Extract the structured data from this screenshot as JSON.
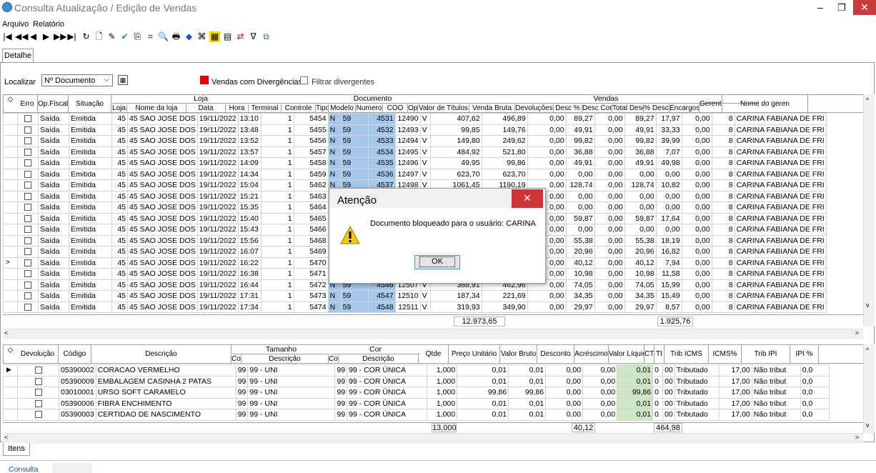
{
  "window": {
    "title": "Consulta Atualização / Edição de Vendas",
    "min": "–",
    "max": "❐",
    "close": "✕"
  },
  "menu": [
    "Arquivo",
    "Relatório"
  ],
  "toolbar": [
    "|◀",
    "◀◀",
    "◀",
    "▶",
    "▶▶",
    "▶|",
    "↻",
    "🗋",
    "✎",
    "✔",
    "⎘",
    "⌗",
    "🔍",
    "🖶",
    "◆",
    "⌘",
    "▦",
    "▤",
    "⇄",
    "∇",
    "⧉"
  ],
  "tabs": {
    "detalhe": "Detalhe",
    "itens": "Itens"
  },
  "filter": {
    "localizar": "Localizar",
    "select": "Nº Documento",
    "legend": "Vendas com Divergências",
    "filtrar": "Filtrar divergentes"
  },
  "colors": {
    "accent": "#a6c8ec",
    "liquido": "#cde6c5",
    "divergencia": "#e60000"
  },
  "sales": {
    "groups": {
      "loja": "Loja",
      "documento": "Documento",
      "vendas": "Vendas"
    },
    "columns": [
      "Erro",
      "Op.Fiscal",
      "Situação",
      "Loja",
      "Nome da loja",
      "Data",
      "Hora",
      "Terminal",
      "Controle",
      "Tipo",
      "Modelo",
      "Numero",
      "COO",
      "Op",
      "Valor de Títulos",
      "Venda Bruta",
      "Devoluções",
      "Desc %",
      "Desc Cort",
      "Total Desc",
      "% Desc",
      "Encargos",
      "Gerente",
      "Nome do geren"
    ],
    "rows": [
      [
        "Saída",
        "Emitida",
        "45",
        "45 SAO JOSE DOS",
        "19/11/2022",
        "13:10",
        "1",
        "5454",
        "N",
        "59",
        "4531",
        "12490",
        "V",
        "407,62",
        "496,89",
        "0,00",
        "89,27",
        "0,00",
        "89,27",
        "17,97",
        "0,00",
        "8",
        "CARINA FABIANA DE FRI"
      ],
      [
        "Saída",
        "Emitida",
        "45",
        "45 SAO JOSE DOS",
        "19/11/2022",
        "13:48",
        "1",
        "5455",
        "N",
        "59",
        "4532",
        "12493",
        "V",
        "99,85",
        "149,76",
        "0,00",
        "49,91",
        "0,00",
        "49,91",
        "33,33",
        "0,00",
        "8",
        "CARINA FABIANA DE FRI"
      ],
      [
        "Saída",
        "Emitida",
        "45",
        "45 SAO JOSE DOS",
        "19/11/2022",
        "13:52",
        "1",
        "5456",
        "N",
        "59",
        "4533",
        "12494",
        "V",
        "149,80",
        "249,62",
        "0,00",
        "99,82",
        "0,00",
        "99,82",
        "39,99",
        "0,00",
        "8",
        "CARINA FABIANA DE FRI"
      ],
      [
        "Saída",
        "Emitida",
        "45",
        "45 SAO JOSE DOS",
        "19/11/2022",
        "13:57",
        "1",
        "5457",
        "N",
        "59",
        "4534",
        "12495",
        "V",
        "484,92",
        "521,80",
        "0,00",
        "36,88",
        "0,00",
        "36,88",
        "7,07",
        "0,00",
        "8",
        "CARINA FABIANA DE FRI"
      ],
      [
        "Saída",
        "Emitida",
        "45",
        "45 SAO JOSE DOS",
        "19/11/2022",
        "14:09",
        "1",
        "5458",
        "N",
        "59",
        "4535",
        "12496",
        "V",
        "49,95",
        "99,86",
        "0,00",
        "49,91",
        "0,00",
        "49,91",
        "49,98",
        "0,00",
        "8",
        "CARINA FABIANA DE FRI"
      ],
      [
        "Saída",
        "Emitida",
        "45",
        "45 SAO JOSE DOS",
        "19/11/2022",
        "14:34",
        "1",
        "5459",
        "N",
        "59",
        "4536",
        "12497",
        "V",
        "623,70",
        "623,70",
        "0,00",
        "0,00",
        "0,00",
        "0,00",
        "0,00",
        "0,00",
        "8",
        "CARINA FABIANA DE FRI"
      ],
      [
        "Saída",
        "Emitida",
        "45",
        "45 SAO JOSE DOS",
        "19/11/2022",
        "15:04",
        "1",
        "5462",
        "N",
        "59",
        "4537",
        "12498",
        "V",
        "1061,45",
        "1190,19",
        "0,00",
        "128,74",
        "0,00",
        "128,74",
        "10,82",
        "0,00",
        "8",
        "CARINA FABIANA DE FRI"
      ],
      [
        "Saída",
        "Emitida",
        "45",
        "45 SAO JOSE DOS",
        "19/11/2022",
        "15:21",
        "1",
        "5463",
        "",
        "",
        "",
        "",
        "",
        "",
        "",
        "0,00",
        "0,00",
        "0,00",
        "0,00",
        "0,00",
        "0,00",
        "8",
        "CARINA FABIANA DE FRI"
      ],
      [
        "Saída",
        "Emitida",
        "45",
        "45 SAO JOSE DOS",
        "19/11/2022",
        "15:35",
        "1",
        "5464",
        "",
        "",
        "",
        "",
        "",
        "",
        "",
        "0,00",
        "0,00",
        "0,00",
        "0,00",
        "0,00",
        "0,00",
        "8",
        "CARINA FABIANA DE FRI"
      ],
      [
        "Saída",
        "Emitida",
        "45",
        "45 SAO JOSE DOS",
        "19/11/2022",
        "15:40",
        "1",
        "5465",
        "",
        "",
        "",
        "",
        "",
        "",
        "",
        "0,00",
        "59,87",
        "0,00",
        "59,87",
        "17,64",
        "0,00",
        "8",
        "CARINA FABIANA DE FRI"
      ],
      [
        "Saída",
        "Emitida",
        "45",
        "45 SAO JOSE DOS",
        "19/11/2022",
        "15:43",
        "1",
        "5466",
        "",
        "",
        "",
        "",
        "",
        "",
        "",
        "0,00",
        "0,00",
        "0,00",
        "0,00",
        "0,00",
        "0,00",
        "8",
        "CARINA FABIANA DE FRI"
      ],
      [
        "Saída",
        "Emitida",
        "45",
        "45 SAO JOSE DOS",
        "19/11/2022",
        "15:56",
        "1",
        "5468",
        "",
        "",
        "",
        "",
        "",
        "",
        "",
        "0,00",
        "55,38",
        "0,00",
        "55,38",
        "18,19",
        "0,00",
        "8",
        "CARINA FABIANA DE FRI"
      ],
      [
        "Saída",
        "Emitida",
        "45",
        "45 SAO JOSE DOS",
        "19/11/2022",
        "16:07",
        "1",
        "5469",
        "",
        "",
        "",
        "",
        "",
        "",
        "",
        "0,00",
        "20,96",
        "0,00",
        "20,96",
        "16,82",
        "0,00",
        "8",
        "CARINA FABIANA DE FRI"
      ],
      [
        "Saída",
        "Emitida",
        "45",
        "45 SAO JOSE DOS",
        "19/11/2022",
        "16:22",
        "1",
        "5470",
        "",
        "",
        "",
        "",
        "",
        "",
        "",
        "0,00",
        "40,12",
        "0,00",
        "40,12",
        "7,94",
        "0,00",
        "8",
        "CARINA FABIANA DE FRI"
      ],
      [
        "Saída",
        "Emitida",
        "45",
        "45 SAO JOSE DOS",
        "19/11/2022",
        "16:38",
        "1",
        "5471",
        "",
        "",
        "",
        "",
        "",
        "",
        "",
        "0,00",
        "10,98",
        "0,00",
        "10,98",
        "11,58",
        "0,00",
        "8",
        "CARINA FABIANA DE FRI"
      ],
      [
        "Saída",
        "Emitida",
        "45",
        "45 SAO JOSE DOS",
        "19/11/2022",
        "16:44",
        "1",
        "5472",
        "N",
        "59",
        "4546",
        "12507",
        "V",
        "388,91",
        "462,96",
        "0,00",
        "74,05",
        "0,00",
        "74,05",
        "15,99",
        "0,00",
        "8",
        "CARINA FABIANA DE FRI"
      ],
      [
        "Saída",
        "Emitida",
        "45",
        "45 SAO JOSE DOS",
        "19/11/2022",
        "17:31",
        "1",
        "5473",
        "N",
        "59",
        "4547",
        "12510",
        "V",
        "187,34",
        "221,69",
        "0,00",
        "34,35",
        "0,00",
        "34,35",
        "15,49",
        "0,00",
        "8",
        "CARINA FABIANA DE FRI"
      ],
      [
        "Saída",
        "Emitida",
        "45",
        "45 SAO JOSE DOS",
        "19/11/2022",
        "17:34",
        "1",
        "5474",
        "N",
        "59",
        "4548",
        "12511",
        "V",
        "319,93",
        "349,90",
        "0,00",
        "29,97",
        "0,00",
        "29,97",
        "8,57",
        "0,00",
        "8",
        "CARINA FABIANA DE FRI"
      ]
    ],
    "totals": {
      "valor_titulos": "12.973,65",
      "total_desc": "1.925,76"
    }
  },
  "items": {
    "groups": {
      "tamanho": "Tamanho",
      "cor": "Cor"
    },
    "columns": [
      "Devolução",
      "Código",
      "Descrição",
      "Cod",
      "Descrição",
      "Cod",
      "Descrição",
      "Qtde",
      "Preço Unitário",
      "Valor Bruto",
      "Desconto",
      "Acréscimo",
      "Valor Líquido",
      "CT",
      "TI",
      "Trib ICMS",
      "ICMS%",
      "Trib IPI",
      "IPI %"
    ],
    "rows": [
      [
        "05390002",
        "CORACAO VERMELHO",
        "99",
        "99 - UNI",
        "99",
        "99 - COR ÚNICA",
        "1,000",
        "0,01",
        "0,01",
        "0,00",
        "0,00",
        "0,01",
        "0",
        "00",
        "Tributado",
        "17,00",
        "Não tribut",
        "0,0"
      ],
      [
        "05390009",
        "EMBALAGEM CASINHA 2 PATAS",
        "99",
        "99 - UNI",
        "99",
        "99 - COR ÚNICA",
        "1,000",
        "0,01",
        "0,01",
        "0,00",
        "0,00",
        "0,01",
        "0",
        "00",
        "Tributado",
        "17,00",
        "Não tribut",
        "0,0"
      ],
      [
        "03010001",
        "URSO SOFT CARAMELO",
        "99",
        "99 - UNI",
        "99",
        "99 - COR ÚNICA",
        "1,000",
        "99,86",
        "99,86",
        "0,00",
        "0,00",
        "99,86",
        "0",
        "00",
        "Tributado",
        "17,00",
        "Não tribut",
        "0,0"
      ],
      [
        "05390006",
        "FIBRA ENCHIMENTO",
        "99",
        "99 - UNI",
        "99",
        "99 - COR ÚNICA",
        "1,000",
        "0,01",
        "0,01",
        "0,00",
        "0,00",
        "0,01",
        "0",
        "00",
        "Tributado",
        "17,00",
        "Não tribut",
        "0,0"
      ],
      [
        "05390003",
        "CERTIDAO DE NASCIMENTO",
        "99",
        "99 - UNI",
        "99",
        "99 - COR ÚNICA",
        "1,000",
        "0,01",
        "0,01",
        "0,00",
        "0,00",
        "0,01",
        "0",
        "00",
        "Tributado",
        "17,00",
        "Não tribut",
        "0,0"
      ]
    ],
    "totals": {
      "qtde": "13,000",
      "desconto": "40,12",
      "valor_liquido": "464,98"
    }
  },
  "dialog": {
    "title": "Atenção",
    "message": "Documento bloqueado para o usuário: CARINA",
    "ok": "OK",
    "close": "✕"
  },
  "status": {
    "consulta": "Consulta"
  }
}
